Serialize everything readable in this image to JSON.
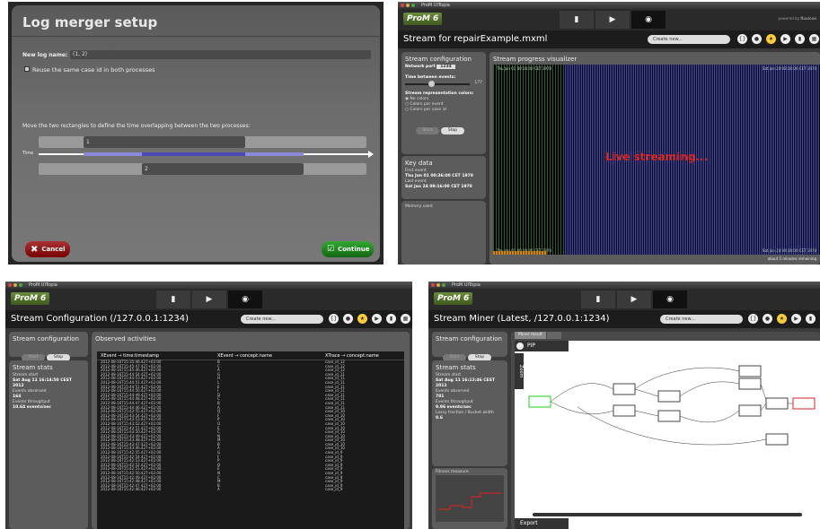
{
  "dialog": {
    "title": "Log merger setup",
    "new_log_label": "New log name:",
    "new_log_value": "(1, 2)",
    "reuse_label": "Reuse the same case id in both processes",
    "instruction": "Move the two rectangles to define the time overlapping between the two processes:",
    "rect1": "1",
    "rect2": "2",
    "time_label": "Time",
    "cancel": "Cancel",
    "continue": "Continue"
  },
  "visualizer": {
    "window_title": "ProM UITopia",
    "logo": "ProM",
    "logo_version": "6",
    "powered": "powered by",
    "powered_brand": "fluxicon",
    "title": "Stream for repairExample.mxml",
    "create_new": "Create new...",
    "config_title": "Stream configuration",
    "network_port_label": "Network port",
    "network_port": "1234",
    "time_between_label": "Time between events:",
    "time_between_value": "177",
    "color_label": "Stream representation colors:",
    "color_options": [
      "No colors",
      "Colors per event",
      "Colors per case id"
    ],
    "start": "Start",
    "stop": "Stop",
    "key_data_title": "Key data",
    "first_event_label": "First event",
    "first_event": "Thu Jan 01 00:36:00 CET 1970",
    "last_event_label": "Last event",
    "last_event": "Sat Jan 24 09:16:00 CET 1970",
    "memory_label": "Memory used",
    "progress_title": "Stream progress visualizer",
    "live": "Live streaming...",
    "top_left_date": "Thu Jan 01 00:36:00 CET 1970",
    "top_right_date": "Sat Jan 24 09:16:00 CET 1970",
    "bottom_left_date": "Thu Jan 01 00:36:00 CET 1970",
    "bottom_right_date": "Sat Jan 24 09:16:00 CET 1970",
    "footer": "about 5 minutes remaining"
  },
  "config": {
    "window_title": "ProM UITopia",
    "title": "Stream Configuration (/127.0.0.1:1234)",
    "create_new": "Create new...",
    "config_title": "Stream configuration",
    "start": "Start",
    "stop": "Stop",
    "stats_title": "Stream stats",
    "stream_start_label": "Stream start",
    "stream_start": "Sat Aug 11 16:14:50 CEST 2012",
    "events_label": "Events observed",
    "events": "164",
    "throughput_label": "Events throughput",
    "throughput": "10.64 events/sec",
    "observed_title": "Observed activities",
    "columns": [
      "XEvent → time:timestamp",
      "XEvent → concept:name",
      "XTrace → concept:name"
    ],
    "rows": [
      [
        "2012-08-16T15:35:46.427+02:00",
        "B",
        "case_id_12"
      ],
      [
        "2012-08-16T15:45:47.427+02:00",
        "C",
        "case_id_12"
      ],
      [
        "2012-08-16T15:45:46.427+02:00",
        "A",
        "case_id_12"
      ],
      [
        "2012-08-16T15:44:54.427+02:00",
        "G",
        "case_id_11"
      ],
      [
        "2012-08-16T15:44:53.427+02:00",
        "H",
        "case_id_11"
      ],
      [
        "2012-08-16T15:44:51.427+02:00",
        "L",
        "case_id_11"
      ],
      [
        "2012-08-16T15:44:51.427+02:00",
        "E",
        "case_id_11"
      ],
      [
        "2012-08-16T15:44:50.427+02:00",
        "I",
        "case_id_11"
      ],
      [
        "2012-08-16T15:44:49.427+02:00",
        "D",
        "case_id_11"
      ],
      [
        "2012-08-16T15:44:48.427+02:00",
        "C",
        "case_id_11"
      ],
      [
        "2012-08-16T15:44:47.427+02:00",
        "B",
        "case_id_11"
      ],
      [
        "2012-08-16T15:44:46.427+02:00",
        "A",
        "case_id_11"
      ],
      [
        "2012-08-16T15:43:55.427+02:00",
        "Q",
        "case_id_10"
      ],
      [
        "2012-08-16T15:43:54.427+02:00",
        "F",
        "case_id_10"
      ],
      [
        "2012-08-16T15:43:53.427+02:00",
        "P",
        "case_id_10"
      ],
      [
        "2012-08-16T15:43:52.427+02:00",
        "O",
        "case_id_10"
      ],
      [
        "2012-08-16T15:43:51.427+02:00",
        "E",
        "case_id_10"
      ],
      [
        "2012-08-16T15:43:50.427+02:00",
        "C",
        "case_id_10"
      ],
      [
        "2012-08-16T15:43:49.427+02:00",
        "N",
        "case_id_10"
      ],
      [
        "2012-08-16T15:43:48.427+02:00",
        "M",
        "case_id_10"
      ],
      [
        "2012-08-16T15:43:47.427+02:00",
        "B",
        "case_id_10"
      ],
      [
        "2012-08-16T15:43:46.427+02:00",
        "A",
        "case_id_10"
      ],
      [
        "2012-08-16T15:42:55.427+02:00",
        "G",
        "case_id_9"
      ],
      [
        "2012-08-16T15:42:54.427+02:00",
        "F",
        "case_id_9"
      ],
      [
        "2012-08-16T15:42:53.427+02:00",
        "P",
        "case_id_9"
      ],
      [
        "2012-08-16T15:42:52.427+02:00",
        "O",
        "case_id_9"
      ],
      [
        "2012-08-16T15:42:51.427+02:00",
        "E",
        "case_id_9"
      ],
      [
        "2012-08-16T15:42:50.427+02:00",
        "N",
        "case_id_9"
      ],
      [
        "2012-08-16T15:42:49.427+02:00",
        "C",
        "case_id_9"
      ],
      [
        "2012-08-16T15:42:48.427+02:00",
        "M",
        "case_id_9"
      ],
      [
        "2012-08-16T15:42:47.427+02:00",
        "B",
        "case_id_9"
      ],
      [
        "2012-08-16T15:42:46.427+02:00",
        "A",
        "case_id_9"
      ]
    ]
  },
  "miner": {
    "window_title": "ProM UITopia",
    "title": "Stream Miner (Latest, /127.0.0.1:1234)",
    "create_new": "Create new...",
    "config_title": "Stream configuration",
    "start": "Start",
    "stop": "Stop",
    "stats_title": "Stream stats",
    "stream_start_label": "Stream start",
    "stream_start": "Sat Aug 11 16:12:46 CEST 2012",
    "events_label": "Events observed",
    "events": "781",
    "throughput_label": "Events throughput",
    "throughput": "9.96 events/sec",
    "memory_label": "Lossy fraction / Bucket width",
    "memory_value": "0.6",
    "tab_miner": "Miner result",
    "tab_other": "",
    "pip": "PIP",
    "zoom": "Zoom",
    "export": "Export",
    "chart_label": "Fitness measure"
  }
}
